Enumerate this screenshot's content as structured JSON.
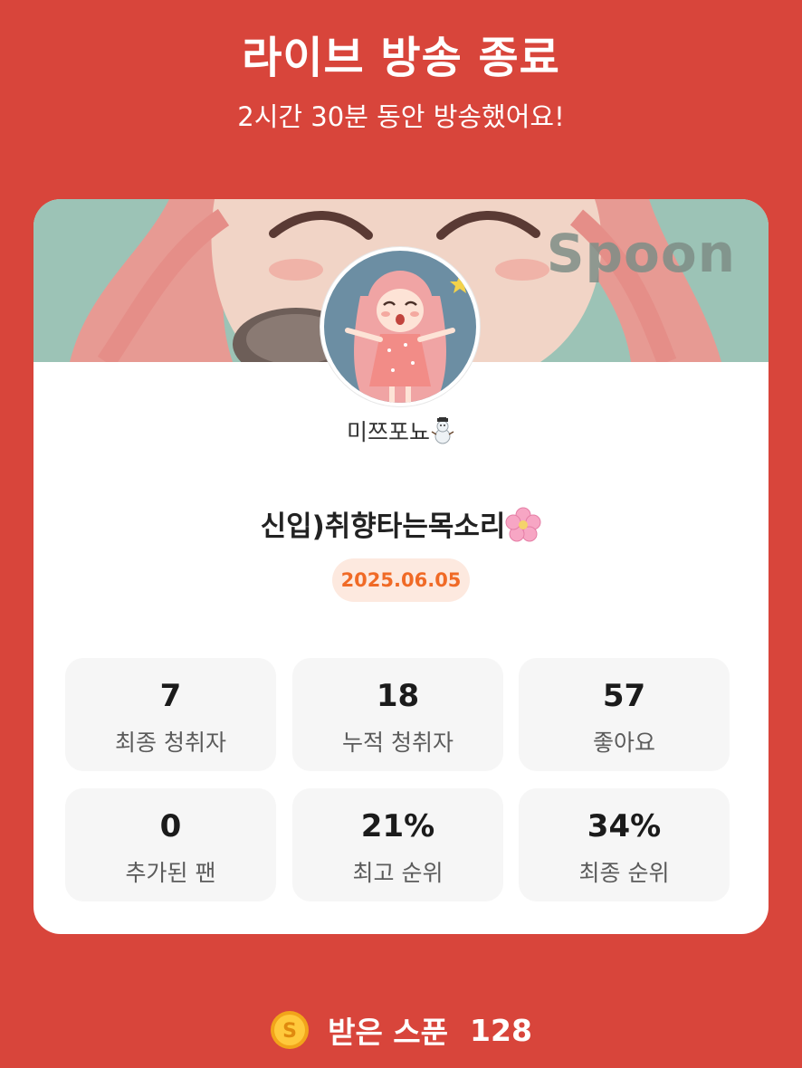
{
  "header": {
    "title": "라이브 방송 종료",
    "subtitle": "2시간 30분 동안 방송했어요!"
  },
  "card": {
    "banner_logo": "Spoon",
    "username": "미쯔포뇨",
    "username_emoji": "snowman-icon",
    "broadcast_title": "신입)취향타는목소리",
    "broadcast_title_emoji": "cherry-blossom-icon",
    "date": "2025.06.05",
    "stats": [
      {
        "value": "7",
        "label": "최종 청취자"
      },
      {
        "value": "18",
        "label": "누적 청취자"
      },
      {
        "value": "57",
        "label": "좋아요"
      },
      {
        "value": "0",
        "label": "추가된 팬"
      },
      {
        "value": "21%",
        "label": "최고 순위"
      },
      {
        "value": "34%",
        "label": "최종 순위"
      }
    ]
  },
  "footer": {
    "spoon_label": "받은 스푼",
    "spoon_count": "128",
    "coin_icon": "spoon-coin-icon"
  },
  "colors": {
    "background": "#d8453b",
    "date_badge_bg": "#fde9df",
    "date_badge_text": "#f06a26",
    "stat_bg": "#f6f6f6",
    "banner_bg": "#9cc3b6"
  }
}
